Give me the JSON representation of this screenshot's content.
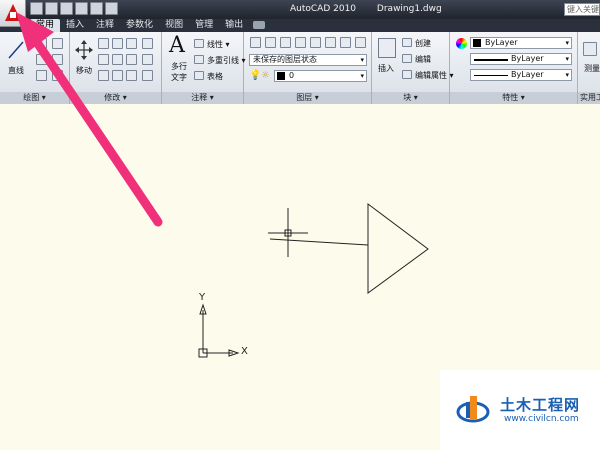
{
  "window": {
    "app_name": "AutoCAD 2010",
    "document": "Drawing1.dwg",
    "search_placeholder": "键入关键字"
  },
  "tabs": [
    "常用",
    "插入",
    "注释",
    "参数化",
    "视图",
    "管理",
    "输出"
  ],
  "ribbon": {
    "draw": {
      "title": "绘图",
      "line_label": "直线"
    },
    "modify": {
      "title": "修改",
      "move_label": "移动"
    },
    "annotation": {
      "title": "注释",
      "mtext_label_1": "多行",
      "mtext_label_2": "文字",
      "linear_label": "线性",
      "multileader_label": "多重引线",
      "table_label": "表格"
    },
    "layers": {
      "title": "图层",
      "layer_state": "未保存的图层状态",
      "current_layer": "0"
    },
    "block": {
      "title": "块",
      "insert_label": "插入",
      "create_label": "创建",
      "edit_label": "编辑",
      "edit_attr_label": "编辑属性"
    },
    "properties": {
      "title": "特性",
      "color": "ByLayer",
      "linetype": "ByLayer",
      "lineweight": "ByLayer"
    },
    "utilities": {
      "title": "实用工",
      "measure_label": "测量"
    }
  },
  "ucs": {
    "x_label": "X",
    "y_label": "Y"
  },
  "watermark": {
    "title": "土木工程网",
    "url": "www.civilcn.com"
  },
  "colors": {
    "canvas": "#fdfcec",
    "annotation_arrow": "#f0307a",
    "titlebar": "#2b313c"
  }
}
